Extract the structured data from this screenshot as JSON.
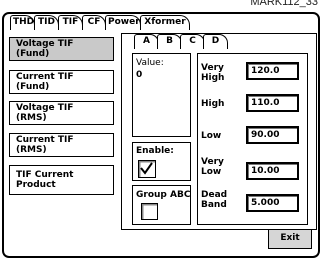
{
  "reference": "MARK112_33",
  "top_tabs": [
    "THD",
    "TID",
    "TIF",
    "CF",
    "Power",
    "Xformer"
  ],
  "side_buttons": [
    "Voltage TIF (Fund)",
    "Current TIF (Fund)",
    "Voltage TIF (RMS)",
    "Current TIF (RMS)",
    "TIF Current Product"
  ],
  "sub_tabs": [
    "A",
    "B",
    "C",
    "D"
  ],
  "value": {
    "label": "Value:",
    "value": "0"
  },
  "enable": {
    "label": "Enable:",
    "checked": true
  },
  "group": {
    "label": "Group ABC",
    "checked": false
  },
  "thresholds": {
    "very_high": {
      "label": "Very High",
      "value": "120.0"
    },
    "high": {
      "label": "High",
      "value": "110.0"
    },
    "low": {
      "label": "Low",
      "value": "90.00"
    },
    "very_low": {
      "label": "Very Low",
      "value": "10.00"
    },
    "dead_band": {
      "label": "Dead Band",
      "value": "5.000"
    }
  },
  "exit_label": "Exit"
}
